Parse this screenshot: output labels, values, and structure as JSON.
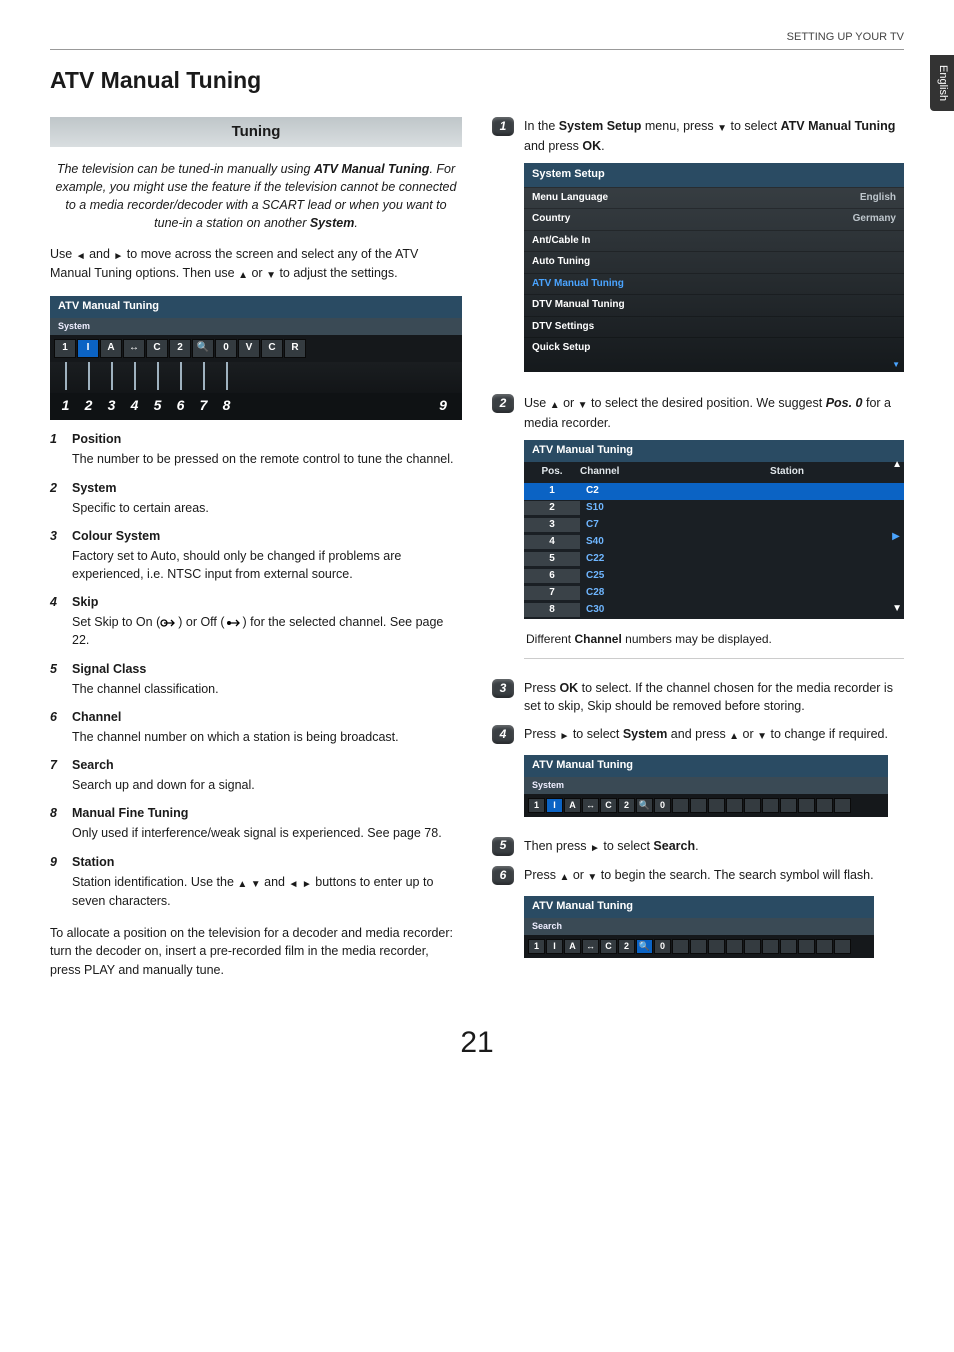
{
  "header": {
    "breadcrumb": "SETTING UP YOUR TV",
    "side_tab": "English"
  },
  "title": "ATV Manual Tuning",
  "tuning_heading": "Tuning",
  "intro": {
    "part1": "The television can be tuned-in manually using ",
    "bold1": "ATV Manual Tuning",
    "part2": ". For example, you might use the feature if the television cannot be connected to a media recorder/decoder with a SCART lead or when you want to tune-in a station on another ",
    "bold2": "System",
    "part3": "."
  },
  "usepara": {
    "p1": "Use ",
    "p2": " and ",
    "p3": " to move across the screen and select any of the ATV Manual Tuning options. Then use ",
    "p4": " or ",
    "p5": " to adjust the settings."
  },
  "leftPanel": {
    "title": "ATV Manual Tuning",
    "sub": "System",
    "cells": [
      "1",
      "I",
      "A",
      "↔",
      "C",
      "2",
      "🔍",
      "0",
      "V",
      "C",
      "R"
    ],
    "nums": [
      "1",
      "2",
      "3",
      "4",
      "5",
      "6",
      "7",
      "8"
    ],
    "numRight": "9"
  },
  "defs": [
    {
      "term": "Position",
      "desc": "The number to be pressed on the remote control to tune the channel."
    },
    {
      "term": "System",
      "desc": "Specific to certain areas."
    },
    {
      "term": "Colour System",
      "desc": "Factory set to Auto, should only be changed if problems are experienced, i.e. NTSC input from external source."
    },
    {
      "term": "Skip",
      "desc": "Set Skip to On () or Off () for the selected channel. See page 22.",
      "hasIcons": true
    },
    {
      "term": "Signal Class",
      "desc": "The channel classification."
    },
    {
      "term": "Channel",
      "desc": "The channel number on which a station is being broadcast."
    },
    {
      "term": "Search",
      "desc": "Search up and down for a signal."
    },
    {
      "term": "Manual Fine Tuning",
      "desc": "Only used if interference/weak signal is experienced. See page 78."
    },
    {
      "term": "Station",
      "desc": "Station identification. Use the  and  buttons to enter up to seven characters.",
      "hasArrows": true
    }
  ],
  "footpara": "To allocate a position on the television for a decoder and media recorder: turn the decoder on, insert a pre-recorded film in the media recorder, press PLAY and manually tune.",
  "steps": {
    "s1": {
      "p1": "In the ",
      "b1": "System Setup",
      "p2": " menu, press ",
      "p3": " to select ",
      "b2": "ATV Manual Tuning",
      "p4": " and press ",
      "b3": "OK",
      "p5": "."
    },
    "s2": {
      "p1": "Use ",
      "p2": " or ",
      "p3": " to select the desired position. We suggest ",
      "b1": "Pos. 0",
      "p4": " for a media recorder."
    },
    "s3": {
      "p1": "Press ",
      "b1": "OK",
      "p2": " to select. If the channel chosen for the media recorder is set to skip, Skip should be removed before storing."
    },
    "s4": {
      "p1": "Press ",
      "p2": " to select ",
      "b1": "System",
      "p3": " and press ",
      "p4": " or ",
      "p5": " to change if required."
    },
    "s5": {
      "p1": "Then press ",
      "p2": " to select ",
      "b1": "Search",
      "p3": "."
    },
    "s6": {
      "p1": "Press ",
      "p2": " or ",
      "p3": " to begin the search. The search symbol will flash."
    }
  },
  "systemMenu": {
    "title": "System Setup",
    "rows": [
      {
        "label": "Menu Language",
        "value": "English"
      },
      {
        "label": "Country",
        "value": "Germany"
      },
      {
        "label": "Ant/Cable In",
        "value": ""
      },
      {
        "label": "Auto Tuning",
        "value": ""
      },
      {
        "label": "ATV Manual Tuning",
        "value": "",
        "sel": true
      },
      {
        "label": "DTV Manual Tuning",
        "value": ""
      },
      {
        "label": "DTV Settings",
        "value": ""
      },
      {
        "label": "Quick Setup",
        "value": ""
      }
    ]
  },
  "chTable": {
    "title": "ATV Manual Tuning",
    "hdr": {
      "c1": "Pos.",
      "c2": "Channel",
      "c3": "Station"
    },
    "rows": [
      {
        "pos": "1",
        "ch": "C2",
        "sel": true
      },
      {
        "pos": "2",
        "ch": "S10"
      },
      {
        "pos": "3",
        "ch": "C7"
      },
      {
        "pos": "4",
        "ch": "S40"
      },
      {
        "pos": "5",
        "ch": "C22"
      },
      {
        "pos": "6",
        "ch": "C25"
      },
      {
        "pos": "7",
        "ch": "C28"
      },
      {
        "pos": "8",
        "ch": "C30"
      }
    ]
  },
  "chNote": {
    "p1": "Different ",
    "b1": "Channel",
    "p2": " numbers may be displayed."
  },
  "panelSystem": {
    "title": "ATV Manual Tuning",
    "sub": "System",
    "cells": [
      "1",
      "I",
      "A",
      "↔",
      "C",
      "2",
      "🔍",
      "0",
      "",
      "",
      "",
      "",
      "",
      "",
      "",
      "",
      "",
      ""
    ],
    "hl": 1
  },
  "panelSearch": {
    "title": "ATV Manual Tuning",
    "sub": "Search",
    "cells": [
      "1",
      "I",
      "A",
      "↔",
      "C",
      "2",
      "🔍",
      "0",
      "",
      "",
      "",
      "",
      "",
      "",
      "",
      "",
      "",
      ""
    ],
    "hl": 6
  },
  "pageNumber": "21"
}
